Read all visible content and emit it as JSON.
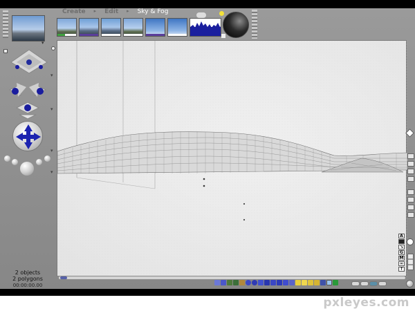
{
  "menu": {
    "items": [
      {
        "label": "Create",
        "state": "dim"
      },
      {
        "label": "Edit",
        "state": "dim"
      },
      {
        "label": "Sky & Fog",
        "state": "active"
      }
    ]
  },
  "status": {
    "objects": "2 objects",
    "polygons": "2 polygons",
    "time": "00:00:00.00"
  },
  "watermark": "pxleyes.com",
  "colors": {
    "accent_purple": "#5b3e9c",
    "app_gray": "#8f8f8f",
    "viewport_bg": "#eaeaea",
    "nav_blue": "#1a1d9e"
  },
  "icons": {
    "preview": "landscape-preview-icon",
    "camera": "camera-pad-icon",
    "move": "move-cross-icon",
    "render": "render-sphere-icon"
  }
}
